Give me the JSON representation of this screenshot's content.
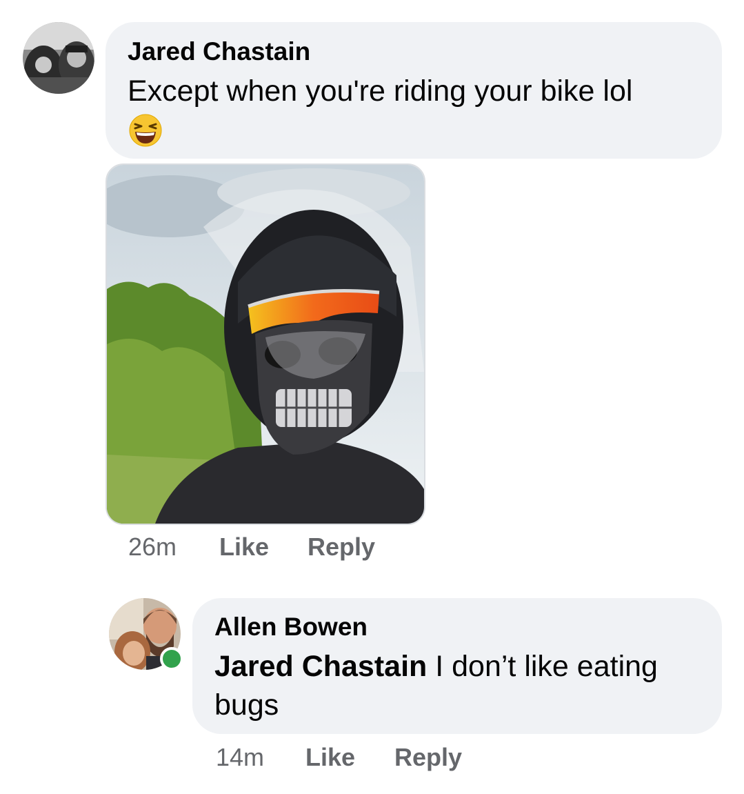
{
  "comments": [
    {
      "author": "Jared Chastain",
      "text": "Except when you're riding your bike lol",
      "emoji": "laughing-face",
      "has_photo": true,
      "time": "26m",
      "like_label": "Like",
      "reply_label": "Reply"
    },
    {
      "author": "Allen Bowen",
      "mention": "Jared Chastain",
      "text_line1": " I don’t like eating",
      "text_line2": "bugs",
      "online": true,
      "time": "14m",
      "like_label": "Like",
      "reply_label": "Reply"
    }
  ],
  "colors": {
    "bubble": "#f0f2f5",
    "meta_text": "#65676b",
    "online_dot": "#31a24c"
  }
}
